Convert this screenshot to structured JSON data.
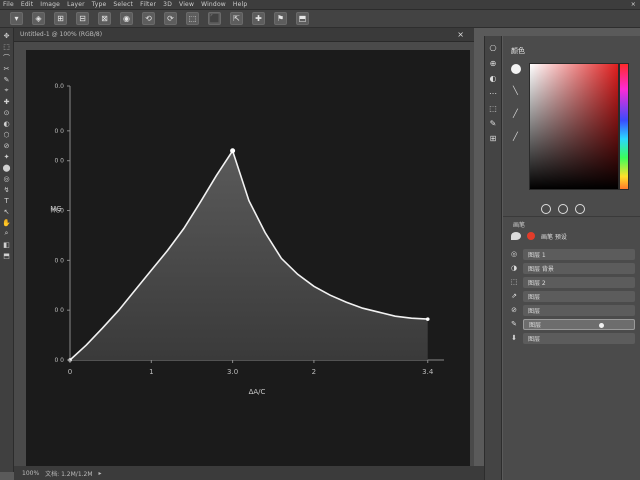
{
  "menubar": {
    "items": [
      "File",
      "Edit",
      "Image",
      "Layer",
      "Type",
      "Select",
      "Filter",
      "3D",
      "View",
      "Window",
      "Help"
    ],
    "window_control": "×"
  },
  "optionsbar": {
    "buttons": [
      "▾",
      "◈",
      "⊞",
      "⊟",
      "⊠",
      "◉",
      "⟲",
      "⟳",
      "⬚",
      "⬛",
      "⇱",
      "✚",
      "⚑",
      "⬒"
    ]
  },
  "tabbar": {
    "tab_label": "Untitled-1 @ 100% (RGB/8)",
    "close": "×"
  },
  "toolbar": {
    "tools": [
      "✥",
      "⬚",
      "⌒",
      "✂",
      "✎",
      "⌖",
      "✚",
      "⊙",
      "◐",
      "⬡",
      "⊘",
      "✦",
      "⬤",
      "◎",
      "↯",
      "T",
      "↖",
      "✋",
      "⌕",
      "◧",
      "⬒"
    ]
  },
  "rightdock": {
    "icons": [
      "⎔",
      "⊕",
      "◐",
      "⋯",
      "⬚",
      "✎",
      "⊞"
    ]
  },
  "panel": {
    "title": "颜色",
    "subhead": "画笔",
    "brush_label": "画笔 预设",
    "layers": [
      {
        "icon": "◎",
        "label": "图层 1"
      },
      {
        "icon": "◑",
        "label": "图层 背景"
      },
      {
        "icon": "⬚",
        "label": "图层 2"
      },
      {
        "icon": "⇗",
        "label": "图层"
      },
      {
        "icon": "⊘",
        "label": "图层"
      },
      {
        "icon": "✎",
        "label": "图层"
      },
      {
        "icon": "⬇",
        "label": "图层"
      }
    ]
  },
  "statusbar": {
    "items": [
      "100%",
      "文档: 1.2M/1.2M",
      "▸"
    ]
  },
  "chart_data": {
    "type": "area",
    "x": [
      0,
      0.5,
      1,
      1.5,
      2,
      2.5,
      3,
      3.5,
      4,
      4.5,
      5,
      5.5,
      6,
      6.5,
      7,
      7.5,
      8,
      8.5,
      9,
      9.5,
      10,
      10.5,
      11
    ],
    "y": [
      0,
      0.15,
      0.32,
      0.5,
      0.7,
      0.9,
      1.1,
      1.32,
      1.58,
      1.85,
      2.1,
      1.6,
      1.28,
      1.02,
      0.86,
      0.74,
      0.65,
      0.58,
      0.52,
      0.48,
      0.44,
      0.42,
      0.41
    ],
    "ylim": [
      0,
      2.75
    ],
    "xlim": [
      0,
      11.5
    ],
    "xtick_labels": [
      "0",
      "1",
      "3.0",
      "2",
      "3.4"
    ],
    "xtick_positions": [
      0,
      2.5,
      5,
      7.5,
      11
    ],
    "ytick_labels": [
      "0 0",
      "0 0",
      "0 0",
      "MG0",
      "0 0",
      "0 0",
      "0.0"
    ],
    "ytick_values": [
      0,
      0.5,
      1.0,
      1.5,
      2.0,
      2.3,
      2.75
    ],
    "ylabel": "MG",
    "xlabel": "ΔA/C",
    "grid": false,
    "peak_marker_x": 5
  }
}
